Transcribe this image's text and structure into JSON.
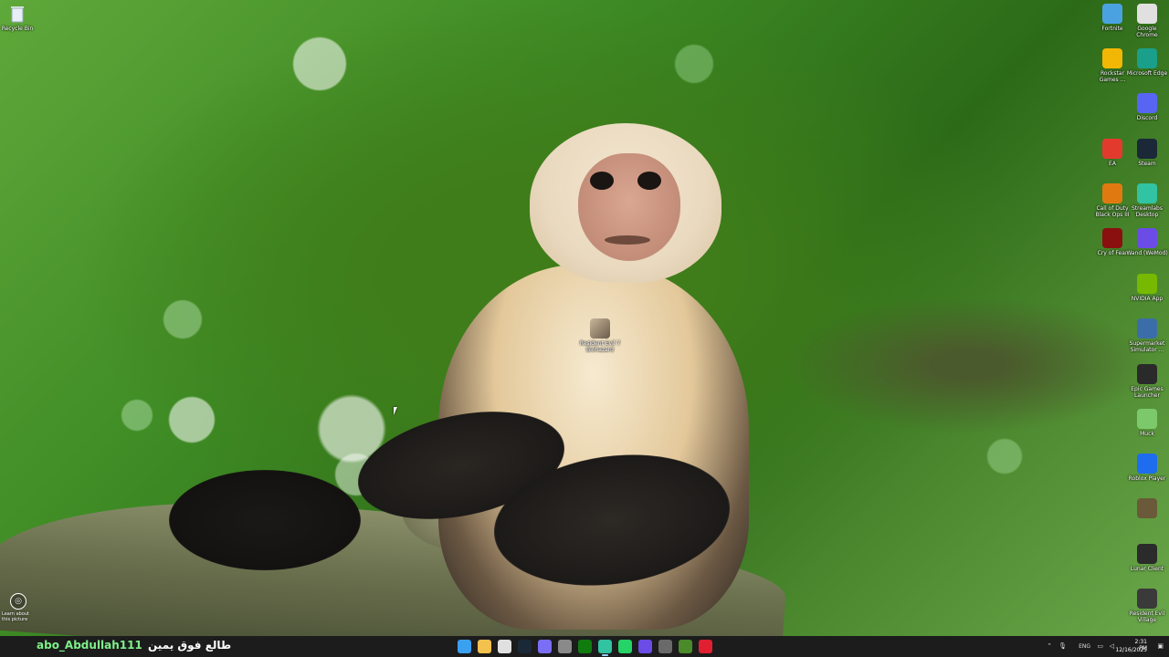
{
  "wallpaper": {
    "subject": "capuchin-monkey-on-branch"
  },
  "desktop": {
    "recycle_bin": "Recycle Bin",
    "center_icon": "Resident Evil 7 Biohazard",
    "learn_picture": "Learn about this picture",
    "right_icons": [
      {
        "label": "Fortnite",
        "icon": "fortnite-icon",
        "color": "#4aa3e0"
      },
      {
        "label": "Google Chrome",
        "icon": "chrome-icon",
        "color": "#e0e0e0"
      },
      {
        "label": "Rockstar Games ...",
        "icon": "rockstar-icon",
        "color": "#f2b705"
      },
      {
        "label": "Microsoft Edge",
        "icon": "edge-icon",
        "color": "#1a9f8a"
      },
      {
        "label": "Discord",
        "icon": "discord-icon",
        "color": "#5865f2"
      },
      {
        "label": "EA",
        "icon": "ea-icon",
        "color": "#e23b2e"
      },
      {
        "label": "Steam",
        "icon": "steam-icon",
        "color": "#1b2838"
      },
      {
        "label": "Call of Duty Black Ops III",
        "icon": "cod-icon",
        "color": "#e07a10"
      },
      {
        "label": "Streamlabs Desktop",
        "icon": "streamlabs-icon",
        "color": "#31c3a2"
      },
      {
        "label": "Cry of Fear",
        "icon": "cry-of-fear-icon",
        "color": "#8a1010"
      },
      {
        "label": "Wand (WeMod)",
        "icon": "wand-icon",
        "color": "#6b4ce6"
      },
      {
        "label": "NVIDIA App",
        "icon": "nvidia-icon",
        "color": "#76b900"
      },
      {
        "label": "Supermarket Simulator ...",
        "icon": "supermarket-icon",
        "color": "#3b6ea8"
      },
      {
        "label": "Epic Games Launcher",
        "icon": "epic-icon",
        "color": "#2a2a2a"
      },
      {
        "label": "Muck",
        "icon": "muck-icon",
        "color": "#7cc96b"
      },
      {
        "label": "Roblox Player",
        "icon": "roblox-icon",
        "color": "#1e6df0"
      },
      {
        "label": "",
        "icon": "game-icon",
        "color": "#6a5a3a"
      },
      {
        "label": "Lunar Client",
        "icon": "lunar-icon",
        "color": "#2b2b2b"
      },
      {
        "label": "Resident Evil Village",
        "icon": "re-village-icon",
        "color": "#3a3a3a"
      }
    ]
  },
  "taskbar": {
    "user": "abo_Abdullah111",
    "arabic": "طالع فوق يمين",
    "apps": [
      {
        "icon": "windows-start-icon",
        "color": "#3aa0f0"
      },
      {
        "icon": "file-explorer-icon",
        "color": "#f2c14e"
      },
      {
        "icon": "chrome-icon",
        "color": "#e0e0e0"
      },
      {
        "icon": "steam-icon",
        "color": "#1b2838"
      },
      {
        "icon": "discord-icon",
        "color": "#7b6ef6"
      },
      {
        "icon": "settings-gear-icon",
        "color": "#8a8a8a"
      },
      {
        "icon": "xbox-icon",
        "color": "#107c10"
      },
      {
        "icon": "streamlabs-icon",
        "color": "#31c3a2"
      },
      {
        "icon": "whatsapp-icon",
        "color": "#25d366"
      },
      {
        "icon": "wand-icon",
        "color": "#6b4ce6"
      },
      {
        "icon": "game-controller-icon",
        "color": "#6a6a6a"
      },
      {
        "icon": "minecraft-icon",
        "color": "#4a8a2a"
      },
      {
        "icon": "pinterest-icon",
        "color": "#e02030"
      }
    ],
    "tray": {
      "language": "ENG",
      "time": "2:31 PM",
      "date": "12/16/2025"
    }
  }
}
